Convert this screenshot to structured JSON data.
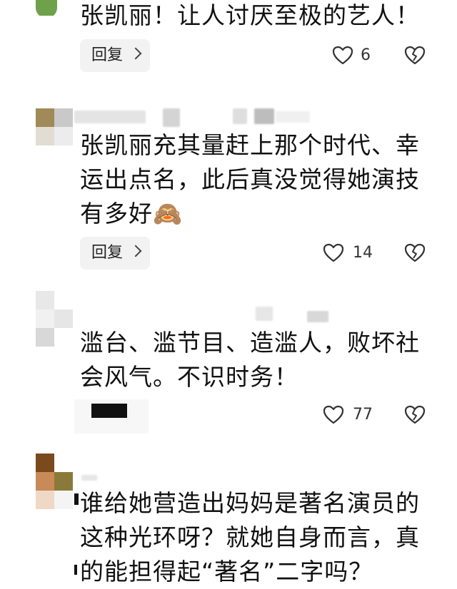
{
  "comments": [
    {
      "text": "张凯丽！让人讨厌至极的艺人！",
      "reply_label": "回复",
      "likes": "6"
    },
    {
      "text": "张凯丽充其量赶上那个时代、幸运出点名，此后真没觉得她演技有多好🙈",
      "reply_label": "回复",
      "likes": "14"
    },
    {
      "text": "滥台、滥节目、造滥人，败坏社会风气。不识时务！",
      "likes": "77"
    },
    {
      "text": "谁给她营造出妈妈是著名演员的这种光环呀？就她自身而言，真的能担得起“著名”二字吗？"
    }
  ],
  "icons": {
    "like": "heart-outline-icon",
    "dislike": "broken-heart-icon",
    "reply_arrow": "chevron-right-icon"
  }
}
